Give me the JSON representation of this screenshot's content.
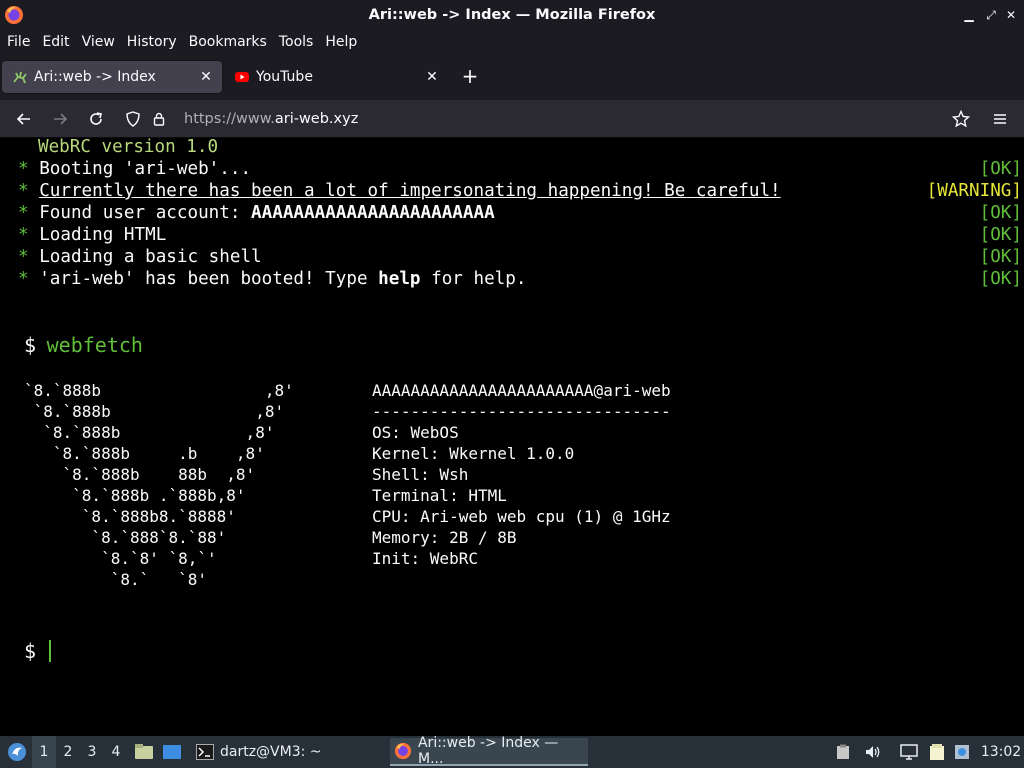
{
  "window": {
    "title": "Ari::web -> Index — Mozilla Firefox",
    "controls": [
      "_",
      "⤢",
      "✕"
    ]
  },
  "menu": [
    "File",
    "Edit",
    "View",
    "History",
    "Bookmarks",
    "Tools",
    "Help"
  ],
  "tabs": [
    {
      "label": "Ari::web -> Index",
      "icon": "lizard-favicon-icon",
      "active": true
    },
    {
      "label": "YouTube",
      "icon": "youtube-icon",
      "active": false
    }
  ],
  "newtab_label": "+",
  "nav": {
    "url_prefix": "https://www.",
    "url_domain": "ari-web.xyz"
  },
  "terminal": {
    "header": "WebRC version 1.0",
    "boot": [
      {
        "bullet": "*",
        "text": "Booting 'ari-web'...",
        "status": "[OK]",
        "kind": "ok"
      },
      {
        "bullet": "*",
        "text": "Currently there has been a lot of impersonating happening! Be careful!",
        "status": "[WARNING]",
        "kind": "warning"
      },
      {
        "bullet": "*",
        "text_pre": "Found user account: ",
        "text_bold": "AAAAAAAAAAAAAAAAAAAAAAA",
        "status": "[OK]",
        "kind": "ok"
      },
      {
        "bullet": "*",
        "text": "Loading HTML",
        "status": "[OK]",
        "kind": "ok"
      },
      {
        "bullet": "*",
        "text": "Loading a basic shell",
        "status": "[OK]",
        "kind": "ok"
      },
      {
        "bullet": "*",
        "text_pre": "'ari-web' has been booted! Type ",
        "text_bold": "help",
        "text_post": " for help.",
        "status": "[OK]",
        "kind": "ok"
      }
    ],
    "prompt": "$",
    "command": "webfetch",
    "ascii_art": "`8.`888b                 ,8'\n `8.`888b               ,8'\n  `8.`888b             ,8'\n   `8.`888b     .b    ,8'\n    `8.`888b    88b  ,8'\n     `8.`888b .`888b,8'\n      `8.`888b8.`8888'\n       `8.`888`8.`88'\n        `8.`8' `8,`'\n         `8.`   `8'",
    "info": [
      "AAAAAAAAAAAAAAAAAAAAAAA@ari-web",
      "-------------------------------",
      "OS: WebOS",
      "Kernel: Wkernel 1.0.0",
      "Shell: Wsh",
      "Terminal: HTML",
      "CPU: Ari-web web cpu (1) @ 1GHz",
      "Memory: 2B / 8B",
      "Init: WebRC"
    ],
    "prompt2": "$"
  },
  "taskbar": {
    "workspaces": [
      "1",
      "2",
      "3",
      "4"
    ],
    "active_workspace": "1",
    "terminal_window": "dartz@VM3: ~",
    "firefox_window": "Ari::web -> Index — M...",
    "clock": "13:02"
  },
  "colors": {
    "ok": "#5fbf3a",
    "warning": "#e5e53a",
    "header": "#b7d97c",
    "taskbar": "#273038"
  }
}
